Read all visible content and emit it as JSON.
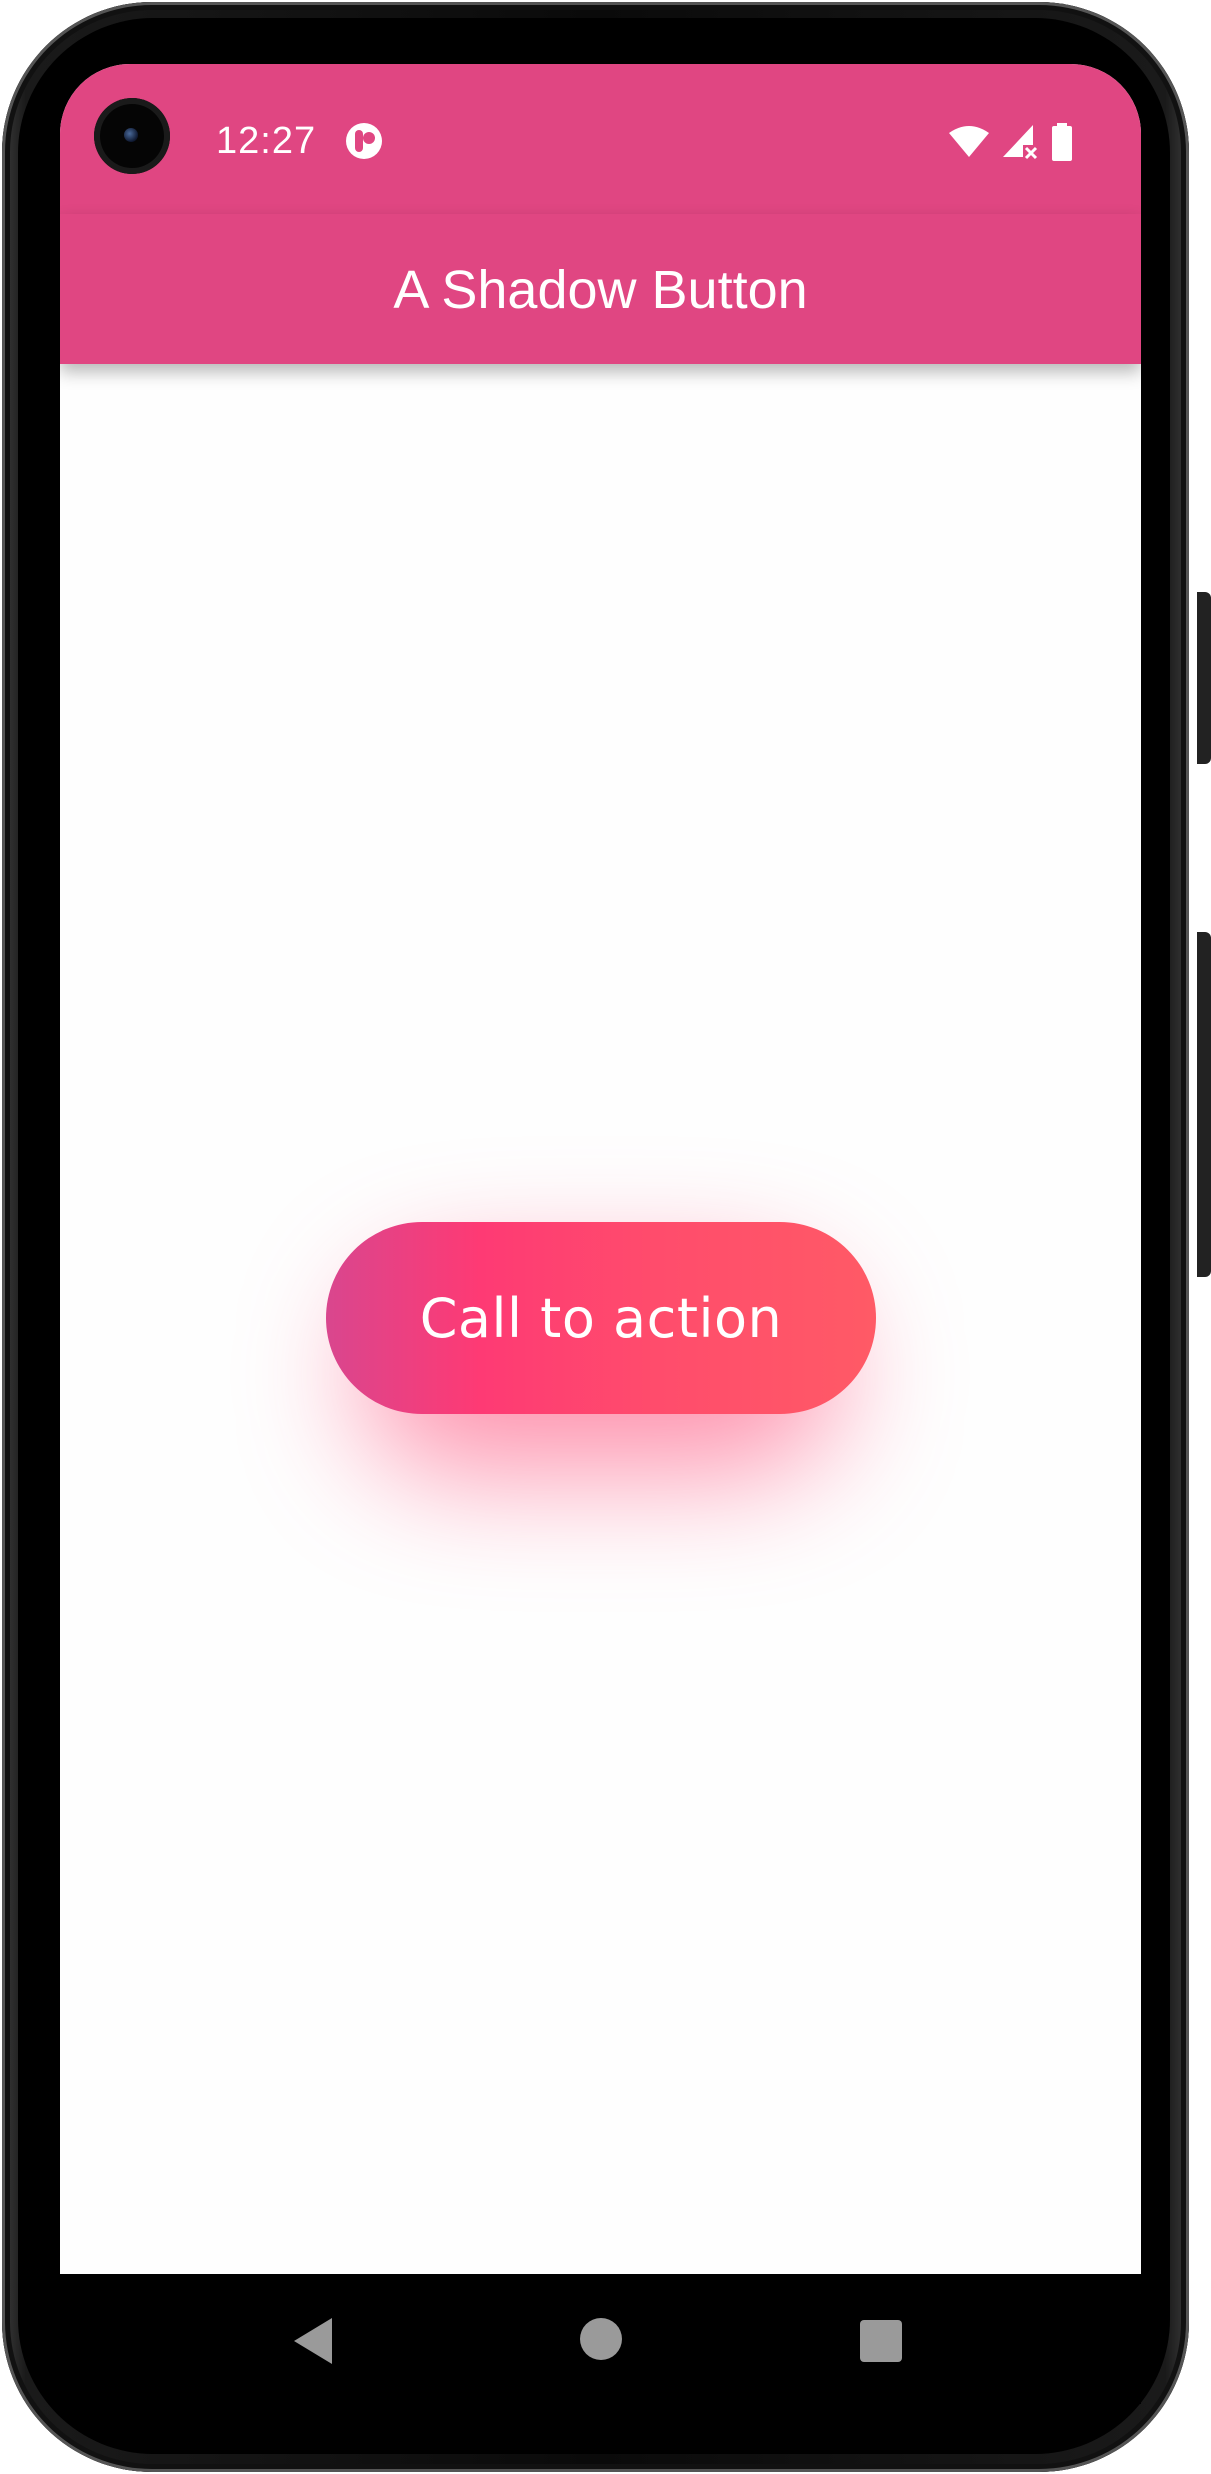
{
  "status_bar": {
    "time": "12:27",
    "icons": [
      "notification-app-icon",
      "wifi-icon",
      "signal-no-service-icon",
      "battery-icon"
    ]
  },
  "app_bar": {
    "title": "A Shadow Button"
  },
  "main": {
    "cta_label": "Call to action"
  },
  "nav_bar": {
    "buttons": [
      "back",
      "home",
      "recents"
    ]
  },
  "colors": {
    "app_bar": "#e04682",
    "cta_gradient_start": "#d9468e",
    "cta_gradient_mid": "#fe3a74",
    "cta_gradient_end": "#ff5a66",
    "background": "#fefefe"
  }
}
